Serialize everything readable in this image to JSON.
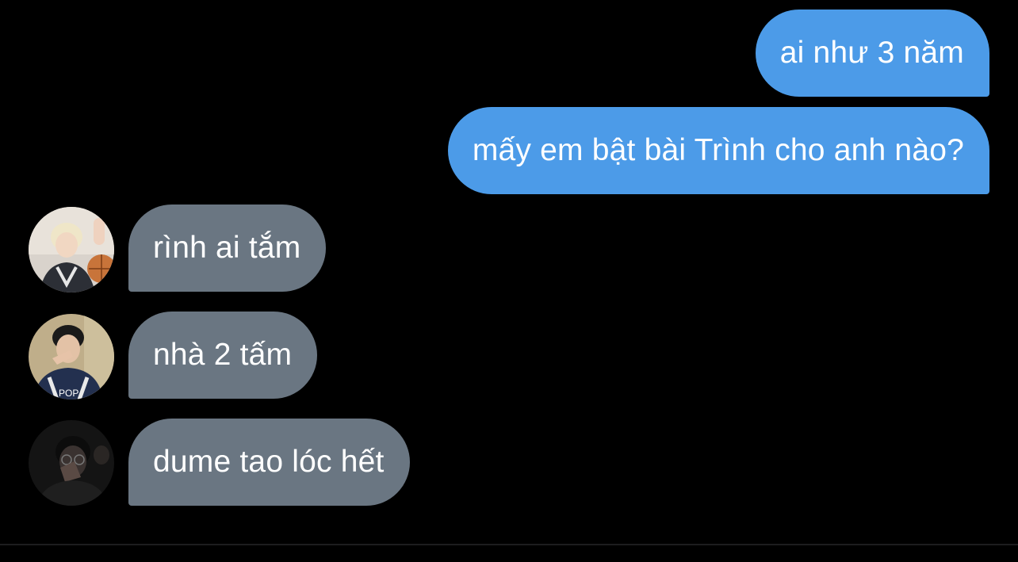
{
  "messages": {
    "sent": [
      {
        "text": "ai như 3 năm"
      },
      {
        "text": "mấy em bật bài Trình cho anh nào?"
      }
    ],
    "received": [
      {
        "text": "rình ai tắm",
        "avatar": "user-avatar-photo-1"
      },
      {
        "text": "nhà 2 tấm",
        "avatar": "user-avatar-photo-2"
      },
      {
        "text": "dume tao lóc hết",
        "avatar": "user-avatar-photo-3"
      }
    ]
  },
  "colors": {
    "background": "#000000",
    "sent_bubble": "#4c9be8",
    "received_bubble": "#6a7682",
    "text": "#ffffff"
  }
}
